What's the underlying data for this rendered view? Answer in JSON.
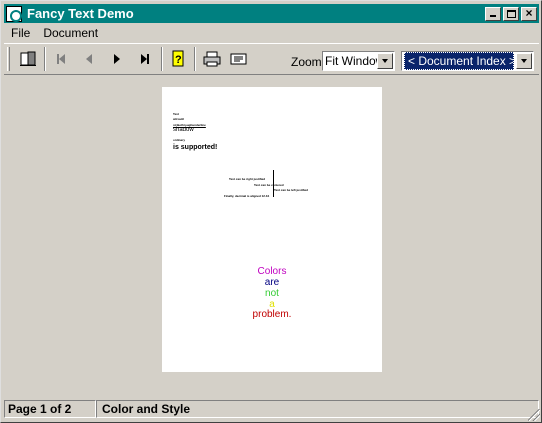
{
  "window": {
    "title": "Fancy Text Demo"
  },
  "menu": {
    "file": "File",
    "document": "Document"
  },
  "toolbar": {
    "zoom_label": "Zoom",
    "zoom_value": "Fit Window",
    "index_value": "< Document Index >"
  },
  "page": {
    "lines": [
      "Text",
      "attrsutil",
      "strikethroughunderline",
      "shadow",
      "ordinary",
      "is supported!"
    ],
    "diagram": [
      "Text can be right justified",
      "Text can be centered",
      "Text can be left justified",
      "Finally, decimal is aligned 12.34"
    ],
    "colors": [
      {
        "text": "Colors",
        "color": "#c000c0"
      },
      {
        "text": "are",
        "color": "#000080"
      },
      {
        "text": "not",
        "color": "#33cc33"
      },
      {
        "text": "a",
        "color": "#e0e000"
      },
      {
        "text": "problem.",
        "color": "#c00000"
      }
    ]
  },
  "status": {
    "page": "Page 1 of 2",
    "section": "Color and Style"
  }
}
